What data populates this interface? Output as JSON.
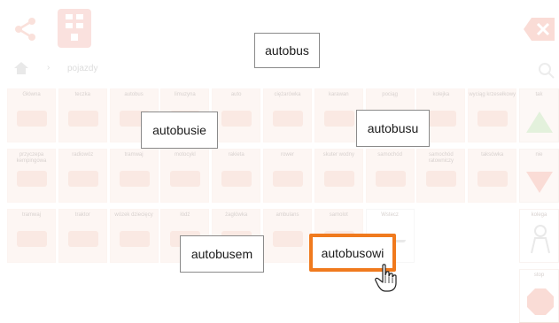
{
  "nav": {
    "breadcrumb": "pojazdy"
  },
  "grid": {
    "rows": [
      [
        "Główna",
        "teczka",
        "autobus",
        "limuzyna",
        "auto",
        "ciężarówka",
        "karawan",
        "pociąg",
        "kolejka",
        "wyciąg krzesełkowy"
      ],
      [
        "przyczepa kempingowa",
        "radiowóz",
        "tramwaj",
        "motocykl",
        "rakieta",
        "rower",
        "skuter wodny",
        "samochód",
        "samochód ratowniczy",
        "taksówka"
      ],
      [
        "tramwaj",
        "traktor",
        "wózek dziecięcy",
        "łódź",
        "żaglówka",
        "ambulans",
        "samolot",
        "Wstecz",
        "",
        ""
      ]
    ]
  },
  "right_col": [
    "tak",
    "nie",
    "kolega",
    "stop"
  ],
  "popups": {
    "p1": "autobus",
    "p2": "autobusie",
    "p3": "autobusu",
    "p4": "autobusem",
    "p5": "autobusowi"
  },
  "colors": {
    "accent": "#f07a1e",
    "tile_bg": "#fbe9e1",
    "brand_red": "#e35b4a"
  }
}
